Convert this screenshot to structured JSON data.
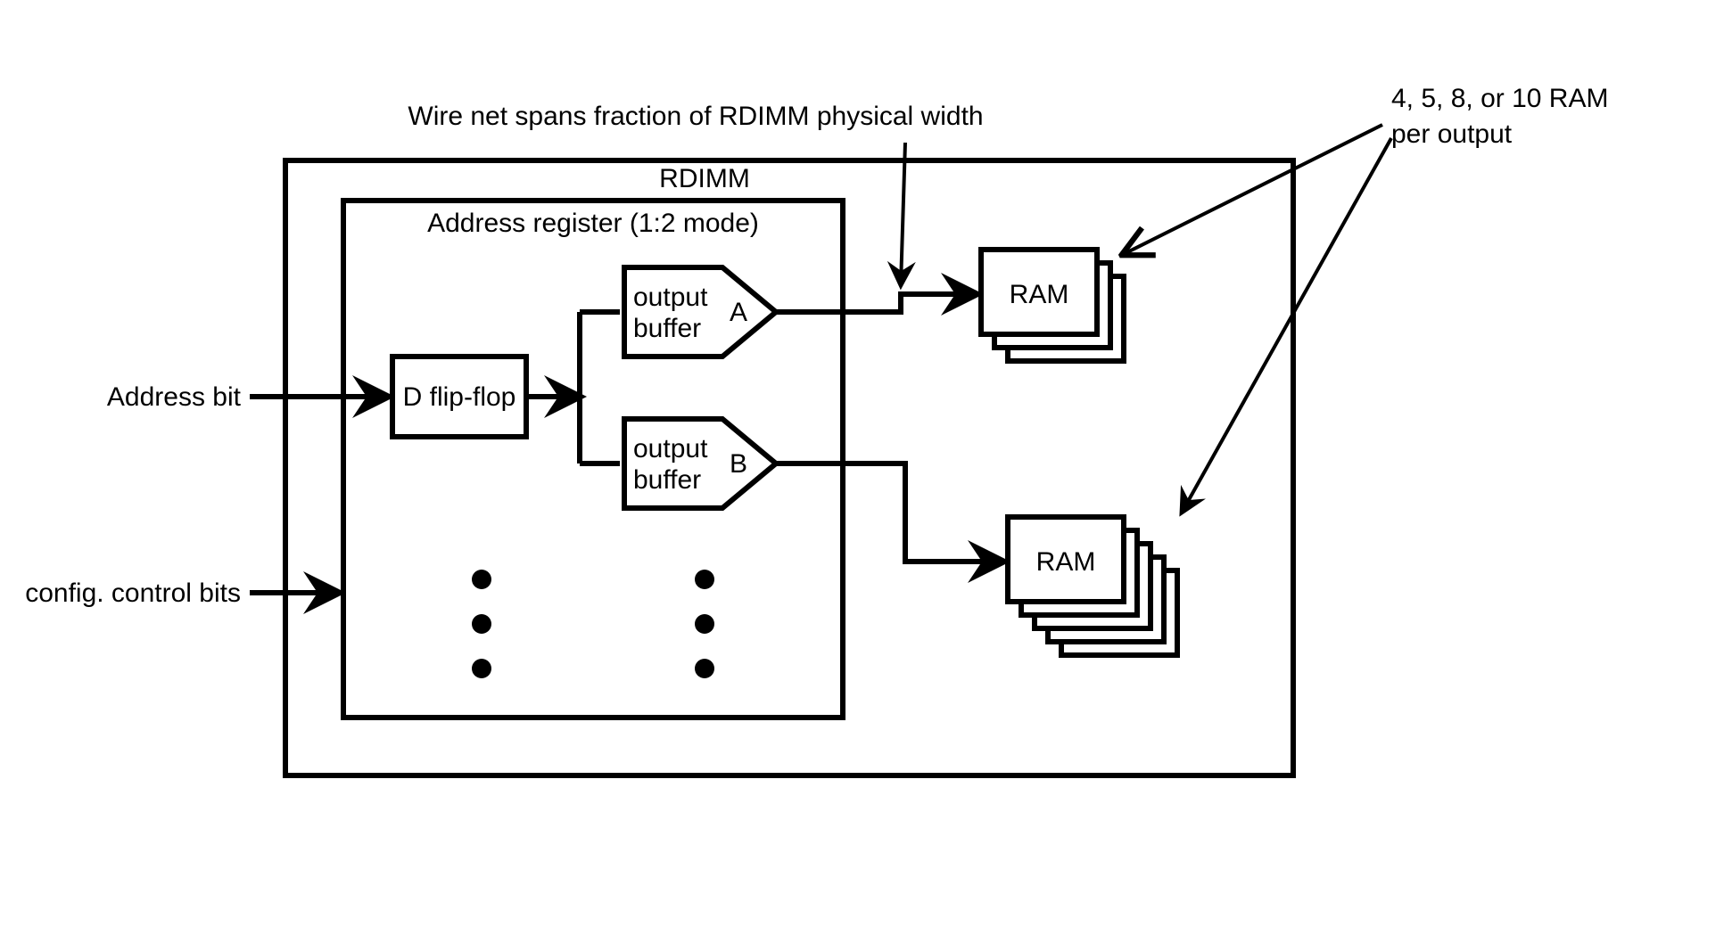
{
  "annotations": {
    "wire_net": "Wire net spans fraction of RDIMM physical width",
    "ram_count": "4, 5, 8, or 10 RAM\nper output"
  },
  "rdimm": {
    "title": "RDIMM"
  },
  "register": {
    "title": "Address register (1:2 mode)"
  },
  "flipflop": "D flip-flop",
  "buffer_a": {
    "line1": "output",
    "line2": "buffer",
    "tag": "A"
  },
  "buffer_b": {
    "line1": "output",
    "line2": "buffer",
    "tag": "B"
  },
  "ram_a": "RAM",
  "ram_b": "RAM",
  "inputs": {
    "address": "Address bit",
    "config": "config. control bits"
  }
}
